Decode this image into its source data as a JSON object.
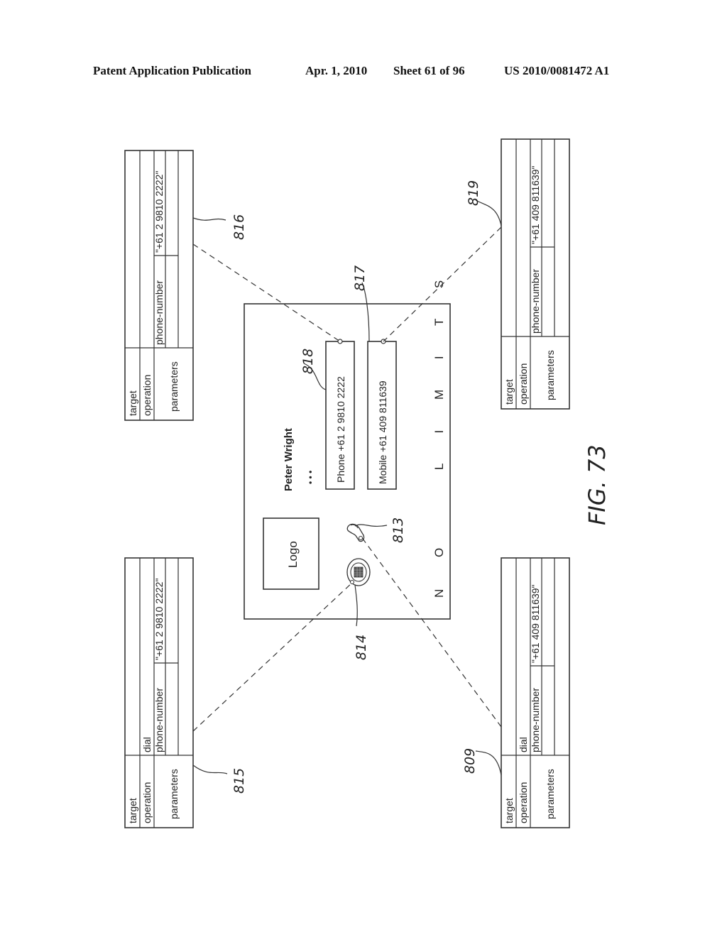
{
  "header": {
    "publication": "Patent Application Publication",
    "date": "Apr. 1, 2010",
    "sheet": "Sheet 61 of 96",
    "number": "US 2010/0081472 A1"
  },
  "figure": {
    "label": "FIG. 73"
  },
  "card": {
    "name": "Peter Wright",
    "dots": "• • •",
    "logo": "Logo",
    "phone_field": "Phone +61 2 9810 2222",
    "mobile_field": "Mobile +61 409 811639",
    "slogan_part1": "N O",
    "slogan_part2": "L I M I T S",
    "ref_phone_field": "818",
    "ref_mobile_field": "817",
    "ref_handset_icon": "813",
    "ref_dial_icon": "814"
  },
  "tables": [
    {
      "ref": "816",
      "rows": {
        "target": "target",
        "operation": "operation",
        "parameters": "parameters"
      },
      "target_value": "",
      "operation_value": "",
      "param_name": "phone-number",
      "param_value": "\"+61 2 9810 2222\""
    },
    {
      "ref": "819",
      "rows": {
        "target": "target",
        "operation": "operation",
        "parameters": "parameters"
      },
      "target_value": "",
      "operation_value": "",
      "param_name": "phone-number",
      "param_value": "\"+61 409 811639\""
    },
    {
      "ref": "815",
      "rows": {
        "target": "target",
        "operation": "operation",
        "parameters": "parameters"
      },
      "target_value": "",
      "operation_value": "dial",
      "param_name": "phone-number",
      "param_value": "\"+61 2 9810 2222\""
    },
    {
      "ref": "809",
      "rows": {
        "target": "target",
        "operation": "operation",
        "parameters": "parameters"
      },
      "target_value": "",
      "operation_value": "dial",
      "param_name": "phone-number",
      "param_value": "\"+61 409 811639\""
    }
  ]
}
